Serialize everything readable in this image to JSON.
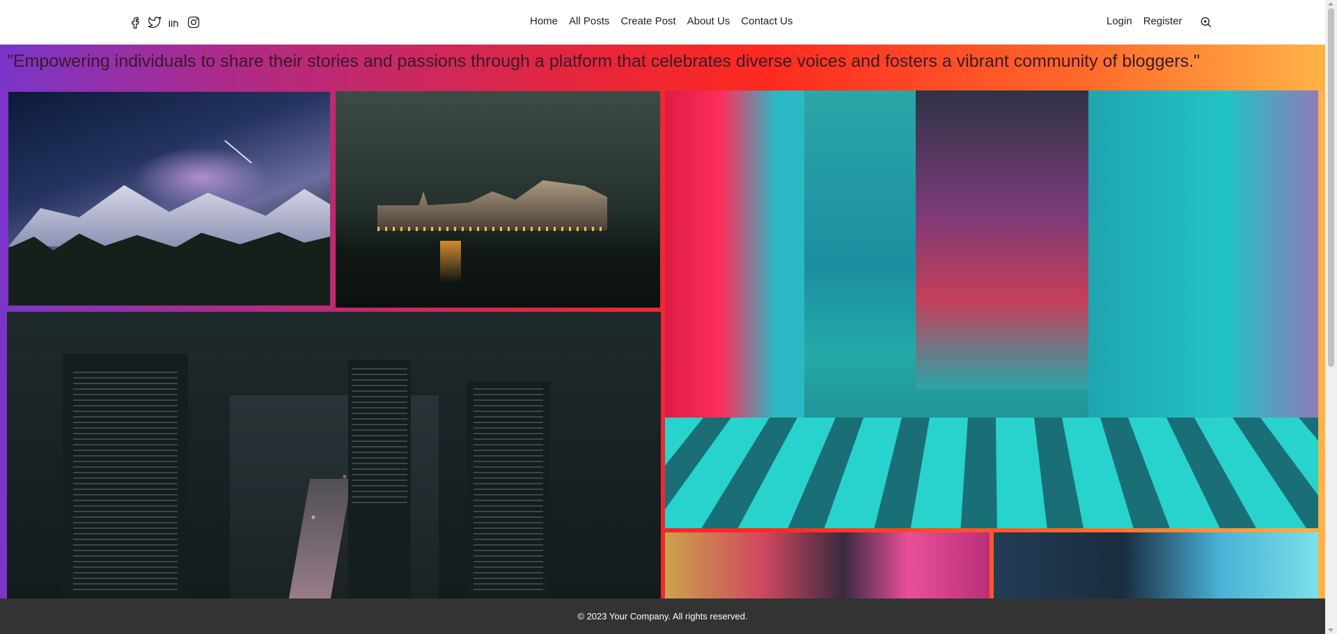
{
  "header": {
    "social": [
      {
        "name": "facebook-icon"
      },
      {
        "name": "twitter-icon"
      },
      {
        "name": "linkedin-icon"
      },
      {
        "name": "instagram-icon"
      }
    ],
    "nav": [
      {
        "label": "Home"
      },
      {
        "label": "All Posts"
      },
      {
        "label": "Create Post"
      },
      {
        "label": "About Us"
      },
      {
        "label": "Contact Us"
      }
    ],
    "auth": {
      "login": "Login",
      "register": "Register"
    },
    "search_icon": "search-icon"
  },
  "hero": {
    "quote": "\"Empowering individuals to share their stories and passions through a platform that celebrates diverse voices and fosters a vibrant community of bloggers.\"",
    "gallery": [
      {
        "name": "milky-way-mountains-image"
      },
      {
        "name": "lakeside-village-night-image"
      },
      {
        "name": "city-skyline-night-image"
      },
      {
        "name": "neon-street-crossing-image"
      },
      {
        "name": "neon-alley-image"
      },
      {
        "name": "city-aerial-neon-image"
      }
    ],
    "colors": {
      "gradient_start": "#7a35c9",
      "gradient_mid": "#ff2a1f",
      "gradient_end": "#ffb347"
    }
  },
  "footer": {
    "text": "© 2023 Your Company. All rights reserved."
  }
}
